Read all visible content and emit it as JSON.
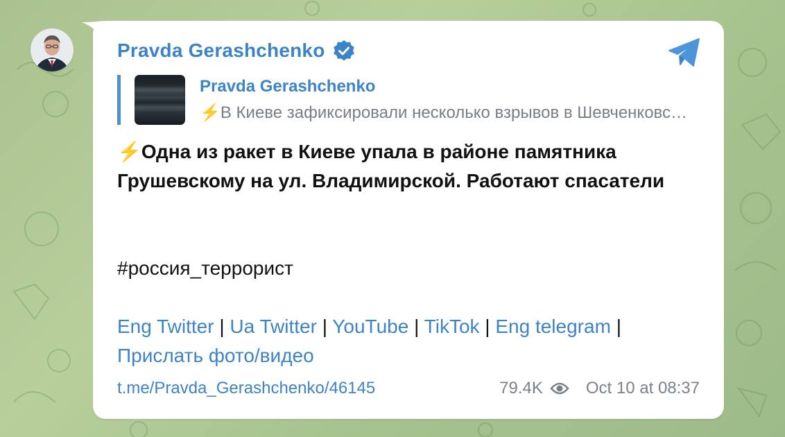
{
  "channel": {
    "name": "Pravda Gerashchenko",
    "verified": true
  },
  "reply": {
    "title": "Pravda Gerashchenko",
    "preview": "⚡️В Киеве зафиксировали несколько взрывов в Шевченковском районе"
  },
  "message": {
    "text": "⚡️Одна из ракет в Киеве упала в районе памятника Грушевскому на ул. Владимирской. Работают спасатели",
    "hashtag": "#россия_террорист",
    "links": [
      {
        "label": "Eng Twitter"
      },
      {
        "label": "Ua Twitter"
      },
      {
        "label": "YouTube"
      },
      {
        "label": "TikTok"
      },
      {
        "label": "Eng telegram"
      },
      {
        "label": "Прислать фото/видео"
      }
    ],
    "separator": "|"
  },
  "footer": {
    "post_link": "t.me/Pravda_Gerashchenko/46145",
    "views": "79.4K",
    "date": "Oct 10 at 08:37"
  },
  "colors": {
    "accent": "#3d83c7",
    "verified": "#3d83c7",
    "share": "#4d95d9",
    "background": "#a9c28f"
  },
  "icons": {
    "verified": "verified-icon",
    "share": "share-telegram-icon",
    "views": "eye-icon"
  }
}
